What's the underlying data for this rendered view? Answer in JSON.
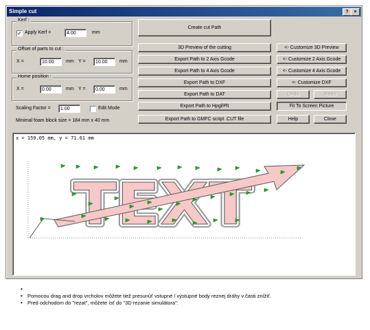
{
  "window": {
    "title": "Simple cut",
    "help_btn": "?",
    "close_btn": "×"
  },
  "kerf": {
    "group_title": "Kerf :",
    "apply_label": "Apply Kerf =",
    "apply_checked": true,
    "value": "4.00",
    "unit": "mm"
  },
  "offset": {
    "group_title": "Offset of parts to cut :",
    "x_label": "X =",
    "x_value": "10.00",
    "x_unit": "mm",
    "y_label": "Y =",
    "y_value": "10.00",
    "y_unit": "mm"
  },
  "home": {
    "group_title": "Home position :",
    "x_label": "X =",
    "x_value": "0.00",
    "x_unit": "mm",
    "y_label": "Y =",
    "y_value": "0.00",
    "y_unit": "mm"
  },
  "scaling": {
    "label": "Scaling Factor =",
    "value": "1.00",
    "edit_mode_label": "Edit Mode",
    "edit_mode_checked": false
  },
  "foam_info": "Minimal foam block size = 184 mm x 40 mm",
  "buttons": {
    "create_cut_path": "Create cut Path",
    "preview_3d": "3D Preview of the cutting",
    "export_2axis": "Export Path to 2 Axis Gcode",
    "export_4axis": "Export Path to 4 Axis Gcode",
    "export_dxf": "Export Path to DXF",
    "export_dat": "Export Path to DAT",
    "export_hpgl": "Export Path to Hpgl/Plt",
    "export_gmfc": "Export Path to GMFC script .CUT file",
    "customize_3d": "<- Customize 3D Preview",
    "customize_2axis": "<- Customize 2 Axis Gcode",
    "customize_4axis": "<- Customize 4 Axis Gcode",
    "customize_dxf": "<- Customize DXF",
    "undo": "Undo",
    "redo": "Redo",
    "fit_to_screen": "Fit To Screen Picture",
    "help": "Help",
    "close": "Close"
  },
  "canvas": {
    "coord_readout": "x = 159.05 mm, y = 71.61 mm",
    "shape_text": "TEXT"
  },
  "notes": [
    "",
    "Pomocou drag and drop vrcholov môžete tiež presunúť vstupné / výstupné body reznej dráhy v časti znížiť.",
    "Pred odchodom do \"rezat\", môžete ísť do \"3D rezanie simulátora\":"
  ],
  "colors": {
    "shape_fill": "#f6c8c8",
    "arrow": "#22aa22",
    "title_bar": "#0a246a"
  }
}
